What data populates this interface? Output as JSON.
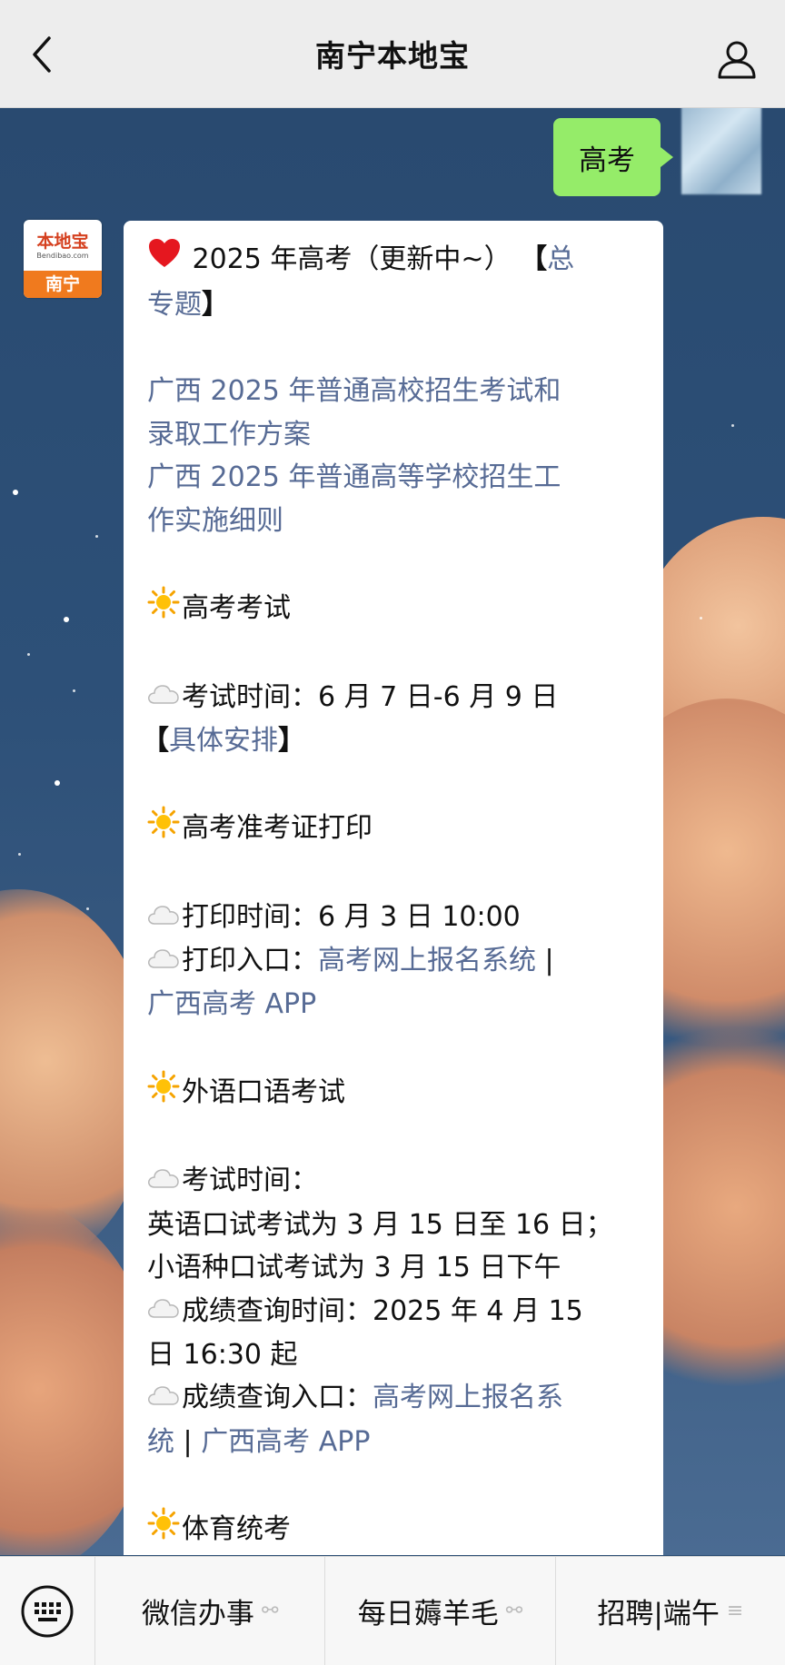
{
  "header": {
    "title": "南宁本地宝"
  },
  "sent_message": {
    "text": "高考"
  },
  "bot_avatar": {
    "logo_text": "本地宝",
    "logo_sub": "Bendibao.com",
    "city": "南宁"
  },
  "message": {
    "l1_title": "2025 年高考（更新中~）",
    "l1_bracket_open": "【",
    "l1_link": "总",
    "l2_link": "专题",
    "l2_bracket_close": "】",
    "doc1_line1": "广西 2025 年普通高校招生考试和",
    "doc1_line2": "录取工作方案",
    "doc2_line1": "广西 2025 年普通高等学校招生工",
    "doc2_line2": "作实施细则",
    "s1_heading": "高考考试",
    "s1_time": "考试时间：6 月 7 日-6 月 9 日",
    "s1_bracket_open": "【",
    "s1_link": "具体安排",
    "s1_bracket_close": "】",
    "s2_heading": "高考准考证打印",
    "s2_time": "打印时间：6 月 3 日 10:00",
    "s2_entry_label": "打印入口：",
    "s2_entry_link1": "高考网上报名系统",
    "s2_sep": " |",
    "s2_entry_link2": "广西高考 APP",
    "s3_heading": "外语口语考试",
    "s3_time_label": "考试时间：",
    "s3_line_en": "英语口试考试为 3 月 15 日至 16 日；",
    "s3_line_minor": "小语种口试考试为 3 月 15 日下午",
    "s3_score_time1": "成绩查询时间：2025 年 4 月 15",
    "s3_score_time2": "日 16:30 起",
    "s3_score_entry_label": "成绩查询入口：",
    "s3_score_link1a": "高考网上报名系",
    "s3_score_link1b": "统",
    "s3_sep": " | ",
    "s3_score_link2": "广西高考 APP",
    "s4_heading": "体育统考"
  },
  "bottom_bar": {
    "items": [
      {
        "label": "微信办事"
      },
      {
        "label": "每日薅羊毛"
      },
      {
        "label": "招聘|端午"
      }
    ]
  },
  "colors": {
    "link": "#576b95",
    "sent_bubble": "#95ec69",
    "header_bg": "#ededed"
  }
}
